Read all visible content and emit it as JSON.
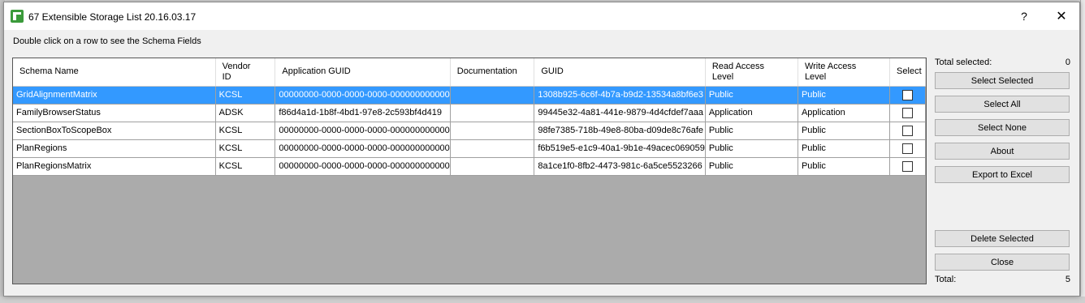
{
  "window": {
    "title": "67 Extensible Storage List 20.16.03.17",
    "help_label": "?",
    "close_label": "✕"
  },
  "instruction": "Double click on a row to see the Schema Fields",
  "table": {
    "columns": [
      {
        "label": "Schema Name"
      },
      {
        "label": "Vendor ID"
      },
      {
        "label": "Application GUID"
      },
      {
        "label": "Documentation"
      },
      {
        "label": "GUID"
      },
      {
        "label": "Read Access Level"
      },
      {
        "label": "Write Access Level"
      },
      {
        "label": "Select"
      }
    ],
    "rows": [
      {
        "schema": "GridAlignmentMatrix",
        "vendor": "KCSL",
        "app_guid": "00000000-0000-0000-0000-000000000000",
        "doc": "",
        "guid": "1308b925-6c6f-4b7a-b9d2-13534a8bf6e3",
        "read": "Public",
        "write": "Public",
        "selected": true
      },
      {
        "schema": "FamilyBrowserStatus",
        "vendor": "ADSK",
        "app_guid": "f86d4a1d-1b8f-4bd1-97e8-2c593bf4d419",
        "doc": "",
        "guid": "99445e32-4a81-441e-9879-4d4cfdef7aaa",
        "read": "Application",
        "write": "Application",
        "selected": false
      },
      {
        "schema": "SectionBoxToScopeBox",
        "vendor": "KCSL",
        "app_guid": "00000000-0000-0000-0000-000000000000",
        "doc": "",
        "guid": "98fe7385-718b-49e8-80ba-d09de8c76afe",
        "read": "Public",
        "write": "Public",
        "selected": false
      },
      {
        "schema": "PlanRegions",
        "vendor": "KCSL",
        "app_guid": "00000000-0000-0000-0000-000000000000",
        "doc": "",
        "guid": "f6b519e5-e1c9-40a1-9b1e-49acec069059",
        "read": "Public",
        "write": "Public",
        "selected": false
      },
      {
        "schema": "PlanRegionsMatrix",
        "vendor": "KCSL",
        "app_guid": "00000000-0000-0000-0000-000000000000",
        "doc": "",
        "guid": "8a1ce1f0-8fb2-4473-981c-6a5ce5523266",
        "read": "Public",
        "write": "Public",
        "selected": false
      }
    ]
  },
  "side": {
    "total_selected_label": "Total selected:",
    "total_selected_value": "0",
    "buttons": {
      "select_selected": "Select Selected",
      "select_all": "Select All",
      "select_none": "Select None",
      "about": "About",
      "export": "Export to Excel",
      "delete_selected": "Delete Selected",
      "close": "Close"
    },
    "total_label": "Total:",
    "total_value": "5"
  },
  "colors": {
    "selection": "#3399ff",
    "grid_empty": "#ababab"
  }
}
